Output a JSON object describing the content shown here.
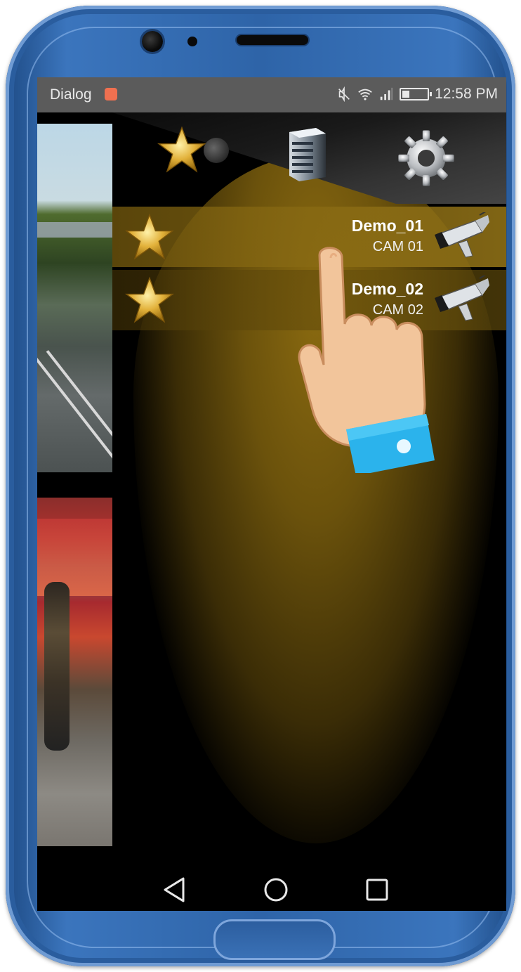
{
  "status_bar": {
    "carrier": "Dialog",
    "time": "12:58 PM",
    "icons": [
      "notification-icon",
      "mute-icon",
      "wifi-icon",
      "signal-icon",
      "battery-icon"
    ]
  },
  "toolbar": {
    "buttons": [
      {
        "name": "favorites",
        "icon": "star-icon"
      },
      {
        "name": "servers",
        "icon": "server-icon"
      },
      {
        "name": "settings",
        "icon": "gear-icon"
      }
    ]
  },
  "cameras": [
    {
      "name": "Demo_01",
      "channel": "CAM 01",
      "icon": "cctv-camera-icon",
      "favorite": true
    },
    {
      "name": "Demo_02",
      "channel": "CAM 02",
      "icon": "cctv-camera-icon",
      "favorite": true
    }
  ],
  "nav_bar": {
    "buttons": [
      "back-icon",
      "home-icon",
      "recents-icon"
    ]
  },
  "colors": {
    "phone_body": "#2e64a8",
    "accent_gold": "#d9a92a",
    "status_bar": "#5b5b5b",
    "handle": "#f08a3e"
  }
}
